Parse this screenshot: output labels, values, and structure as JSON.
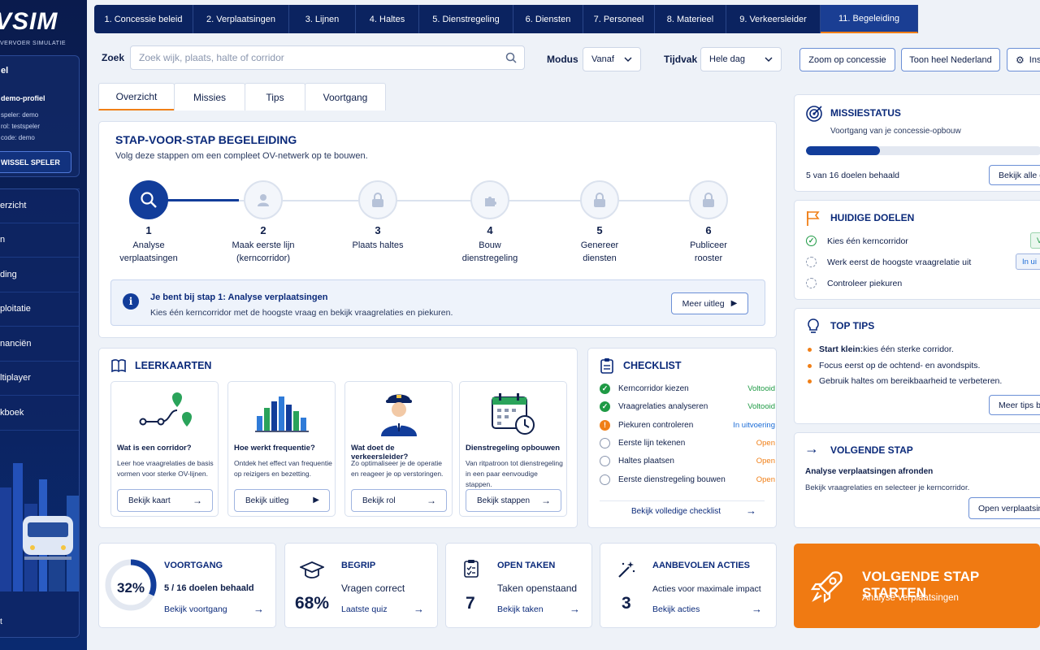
{
  "app": {
    "logo_text": "VSIM",
    "logo_sub": "VERVOER SIMULATIE"
  },
  "profile": {
    "title": "el",
    "name": "demo-profiel",
    "lines": [
      "speler: demo",
      "rol: testspeler",
      "code: demo"
    ],
    "switch_label": "WISSEL SPELER"
  },
  "sidebar": {
    "items": [
      "erzicht",
      "n",
      "ding",
      "ploitatie",
      "nanciën",
      "ltiplayer",
      "kboek"
    ],
    "bottom_text": "t"
  },
  "tabs": [
    {
      "label": "1. Concessie beleid",
      "active": false
    },
    {
      "label": "2. Verplaatsingen",
      "active": false
    },
    {
      "label": "3. Lijnen",
      "active": false
    },
    {
      "label": "4. Haltes",
      "active": false
    },
    {
      "label": "5. Dienstregeling",
      "active": false
    },
    {
      "label": "6. Diensten",
      "active": false
    },
    {
      "label": "7. Personeel",
      "active": false
    },
    {
      "label": "8. Materieel",
      "active": false
    },
    {
      "label": "9. Verkeersleider",
      "active": false
    },
    {
      "label": "11. Begeleiding",
      "active": true
    }
  ],
  "search": {
    "label": "Zoek",
    "placeholder": "Zoek wijk, plaats, halte of corridor",
    "modus_label": "Modus",
    "modus_value": "Vanaf",
    "tijdvak_label": "Tijdvak",
    "tijdvak_value": "Hele dag",
    "zoom_btn": "Zoom op concessie",
    "nl_btn": "Toon heel Nederland",
    "ins_btn": "Ins"
  },
  "subtabs": [
    {
      "label": "Overzicht",
      "active": true
    },
    {
      "label": "Missies",
      "active": false
    },
    {
      "label": "Tips",
      "active": false
    },
    {
      "label": "Voortgang",
      "active": false
    }
  ],
  "guide": {
    "title": "STAP-VOOR-STAP BEGELEIDING",
    "subtitle": "Volg deze stappen om een compleet OV-netwerk op te bouwen.",
    "steps": [
      {
        "num": "1",
        "line1": "Analyse",
        "line2": "verplaatsingen",
        "icon": "search-icon"
      },
      {
        "num": "2",
        "line1": "Maak eerste lijn",
        "line2": "(kerncorridor)",
        "icon": "user-icon"
      },
      {
        "num": "3",
        "line1": "Plaats haltes",
        "line2": "",
        "icon": "lock-icon"
      },
      {
        "num": "4",
        "line1": "Bouw",
        "line2": "dienstregeling",
        "icon": "puzzle-icon"
      },
      {
        "num": "5",
        "line1": "Genereer",
        "line2": "diensten",
        "icon": "lock-icon"
      },
      {
        "num": "6",
        "line1": "Publiceer",
        "line2": "rooster",
        "icon": "lock-icon"
      }
    ],
    "info_title": "Je bent bij stap 1: Analyse verplaatsingen",
    "info_desc": "Kies één kerncorridor met de hoogste vraag en bekijk vraagrelaties en piekuren.",
    "more_btn": "Meer uitleg"
  },
  "leerkaarten": {
    "title": "LEERKAARTEN",
    "cards": [
      {
        "title": "Wat is een corridor?",
        "desc": "Leer hoe vraagrelaties de basis vormen voor sterke OV-lijnen.",
        "btn": "Bekijk kaart",
        "btn_icon": "arrow-right-icon"
      },
      {
        "title": "Hoe werkt frequentie?",
        "desc": "Ontdek het effect van frequentie op reizigers en bezetting.",
        "btn": "Bekijk uitleg",
        "btn_icon": "play-icon"
      },
      {
        "title": "Wat doet de verkeersleider?",
        "desc": "Zo optimaliseer je de operatie en reageer je op verstoringen.",
        "btn": "Bekijk rol",
        "btn_icon": "arrow-right-icon"
      },
      {
        "title": "Dienstregeling opbouwen",
        "desc": "Van ritpatroon tot dienstregeling in een paar eenvoudige stappen.",
        "btn": "Bekijk stappen",
        "btn_icon": "arrow-right-icon"
      }
    ]
  },
  "checklist": {
    "title": "CHECKLIST",
    "items": [
      {
        "label": "Kerncorridor kiezen",
        "status": "Voltooid",
        "state": "done"
      },
      {
        "label": "Vraagrelaties analyseren",
        "status": "Voltooid",
        "state": "done"
      },
      {
        "label": "Piekuren controleren",
        "status": "In uitvoering",
        "state": "progress"
      },
      {
        "label": "Eerste lijn tekenen",
        "status": "Open",
        "state": "open"
      },
      {
        "label": "Haltes plaatsen",
        "status": "Open",
        "state": "open"
      },
      {
        "label": "Eerste dienstregeling bouwen",
        "status": "Open",
        "state": "open"
      }
    ],
    "footer": "Bekijk volledige checklist"
  },
  "stats": {
    "voortgang": {
      "title": "VOORTGANG",
      "percent": "32%",
      "fraction": 0.32,
      "line": "5 / 16 doelen behaald",
      "link": "Bekijk voortgang"
    },
    "begrip": {
      "title": "BEGRIP",
      "value": "68%",
      "line": "Vragen correct",
      "link": "Laatste quiz"
    },
    "open_taken": {
      "title": "OPEN TAKEN",
      "value": "7",
      "line": "Taken openstaand",
      "link": "Bekijk taken"
    },
    "acties": {
      "title": "AANBEVOLEN ACTIES",
      "value": "3",
      "line": "Acties voor maximale impact",
      "link": "Bekijk acties"
    }
  },
  "missiestatus": {
    "title": "MISSIESTATUS",
    "subtitle": "Voortgang van je concessie-opbouw",
    "progress": 0.3125,
    "count_text": "5 van 16 doelen behaald",
    "btn": "Bekijk alle d"
  },
  "doelen": {
    "title": "HUIDIGE DOELEN",
    "items": [
      {
        "label": "Kies één kerncorridor",
        "state": "done",
        "badge": "V"
      },
      {
        "label": "Werk eerst de hoogste vraagrelatie uit",
        "state": "open",
        "badge": "In ui"
      },
      {
        "label": "Controleer piekuren",
        "state": "open",
        "badge": ""
      }
    ]
  },
  "tips": {
    "title": "TOP TIPS",
    "items": [
      {
        "bold": "Start klein:",
        "text": " kies één sterke corridor."
      },
      {
        "bold": "",
        "text": "Focus eerst op de ochtend- en avondspits."
      },
      {
        "bold": "",
        "text": "Gebruik haltes om bereikbaarheid te verbeteren."
      }
    ],
    "btn": "Meer tips b"
  },
  "volgende": {
    "title": "VOLGENDE STAP",
    "heading": "Analyse verplaatsingen afronden",
    "desc": "Bekijk vraagrelaties en selecteer je kerncorridor.",
    "btn": "Open verplaatsin"
  },
  "cta": {
    "title": "VOLGENDE STAP STARTEN",
    "subtitle": "Analyse verplaatsingen"
  },
  "colors": {
    "navy": "#0b2360",
    "accent_blue": "#123d9a",
    "orange": "#f07a12",
    "green": "#1f9a45",
    "info_blue": "#1a6bd6"
  }
}
